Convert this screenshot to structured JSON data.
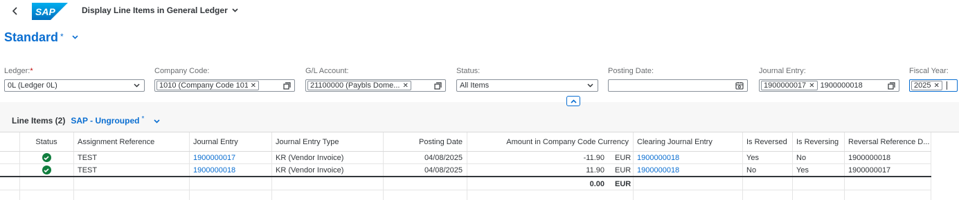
{
  "shell": {
    "logo_text": "SAP",
    "app_title": "Display Line Items in General Ledger"
  },
  "variant": {
    "name": "Standard",
    "modified_marker": "*"
  },
  "filters": {
    "ledger": {
      "label": "Ledger:",
      "required_marker": "*",
      "value": "0L (Ledger 0L)"
    },
    "company_code": {
      "label": "Company Code:",
      "token": "1010 (Company Code 1010)"
    },
    "gl_account": {
      "label": "G/L Account:",
      "token": "21100000 (Paybls Dome..."
    },
    "status": {
      "label": "Status:",
      "value": "All Items"
    },
    "posting_date": {
      "label": "Posting Date:",
      "value": ""
    },
    "journal_entry": {
      "label": "Journal Entry:",
      "token": "1900000017",
      "text": "1900000018"
    },
    "fiscal_year": {
      "label": "Fiscal Year:",
      "token": "2025"
    }
  },
  "table": {
    "title": "Line Items (2)",
    "variant": "SAP - Ungrouped",
    "variant_modified_marker": "*",
    "columns": {
      "status": "Status",
      "assignment": "Assignment Reference",
      "journal_entry": "Journal Entry",
      "je_type": "Journal Entry Type",
      "posting_date": "Posting Date",
      "amount": "Amount in Company Code Currency",
      "clearing": "Clearing Journal Entry",
      "is_reversed": "Is Reversed",
      "is_reversing": "Is Reversing",
      "reversal_ref": "Reversal Reference D..."
    },
    "rows": [
      {
        "status": "cleared",
        "assignment": "TEST",
        "journal_entry": "1900000017",
        "je_type": "KR (Vendor Invoice)",
        "posting_date": "04/08/2025",
        "amount": "-11.90",
        "currency": "EUR",
        "clearing": "1900000018",
        "is_reversed": "Yes",
        "is_reversing": "No",
        "reversal_ref": "1900000018"
      },
      {
        "status": "cleared",
        "assignment": "TEST",
        "journal_entry": "1900000018",
        "je_type": "KR (Vendor Invoice)",
        "posting_date": "04/08/2025",
        "amount": "11.90",
        "currency": "EUR",
        "clearing": "1900000018",
        "is_reversed": "No",
        "is_reversing": "Yes",
        "reversal_ref": "1900000017"
      }
    ],
    "total": {
      "amount": "0.00",
      "currency": "EUR"
    }
  },
  "colors": {
    "accent": "#0a6ed1",
    "success": "#107e3e",
    "required": "#bb0000"
  }
}
